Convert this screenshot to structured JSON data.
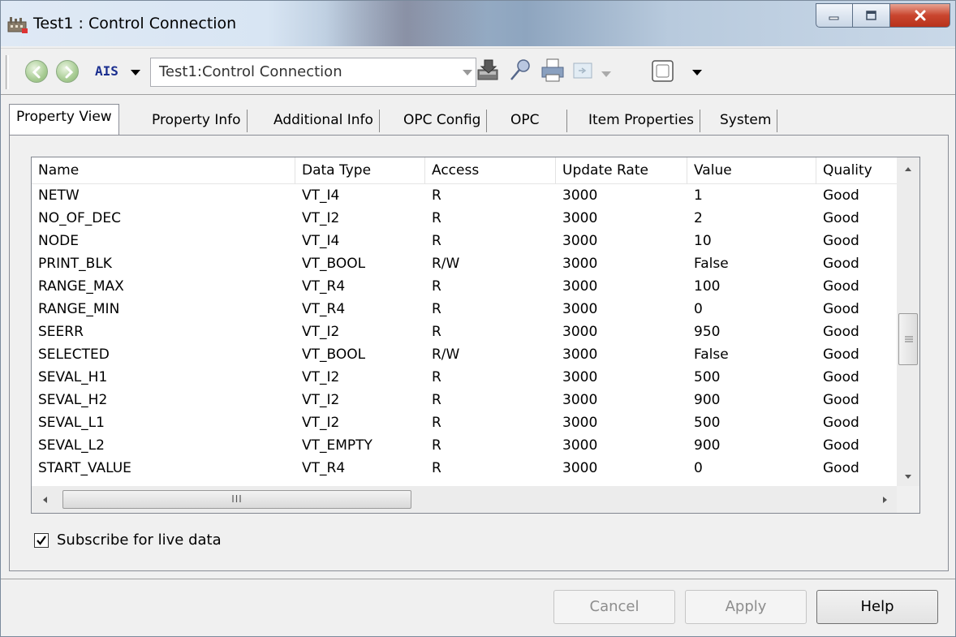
{
  "window": {
    "title": "Test1 : Control Connection",
    "caption_buttons": [
      "minimize-icon",
      "maximize-icon",
      "close-icon"
    ]
  },
  "toolbar": {
    "back_icon": "back-arrow-icon",
    "forward_icon": "forward-arrow-icon",
    "object_type_label": "AIS",
    "address_value": "Test1:Control Connection",
    "tool_icons": [
      "download-icon",
      "pin-icon",
      "print-icon",
      "config-icon",
      "window-icon"
    ]
  },
  "tabs": [
    {
      "label": "Property View",
      "active": true
    },
    {
      "label": "Property Info",
      "active": false
    },
    {
      "label": "Additional Info",
      "active": false
    },
    {
      "label": "OPC Config",
      "active": false
    },
    {
      "label": "OPC",
      "active": false
    },
    {
      "label": "Item Properties",
      "active": false
    },
    {
      "label": "System",
      "active": false
    }
  ],
  "grid": {
    "columns": [
      "Name",
      "Data Type",
      "Access",
      "Update Rate",
      "Value",
      "Quality"
    ],
    "rows": [
      [
        "NETW",
        "VT_I4",
        "R",
        "3000",
        "1",
        "Good"
      ],
      [
        "NO_OF_DEC",
        "VT_I2",
        "R",
        "3000",
        "2",
        "Good"
      ],
      [
        "NODE",
        "VT_I4",
        "R",
        "3000",
        "10",
        "Good"
      ],
      [
        "PRINT_BLK",
        "VT_BOOL",
        "R/W",
        "3000",
        "False",
        "Good"
      ],
      [
        "RANGE_MAX",
        "VT_R4",
        "R",
        "3000",
        "100",
        "Good"
      ],
      [
        "RANGE_MIN",
        "VT_R4",
        "R",
        "3000",
        "0",
        "Good"
      ],
      [
        "SEERR",
        "VT_I2",
        "R",
        "3000",
        "950",
        "Good"
      ],
      [
        "SELECTED",
        "VT_BOOL",
        "R/W",
        "3000",
        "False",
        "Good"
      ],
      [
        "SEVAL_H1",
        "VT_I2",
        "R",
        "3000",
        "500",
        "Good"
      ],
      [
        "SEVAL_H2",
        "VT_I2",
        "R",
        "3000",
        "900",
        "Good"
      ],
      [
        "SEVAL_L1",
        "VT_I2",
        "R",
        "3000",
        "500",
        "Good"
      ],
      [
        "SEVAL_L2",
        "VT_EMPTY",
        "R",
        "3000",
        "900",
        "Good"
      ],
      [
        "START_VALUE",
        "VT_R4",
        "R",
        "3000",
        "0",
        "Good"
      ]
    ],
    "hscroll_thumb_grip": "III"
  },
  "subscribe": {
    "label": "Subscribe for live data",
    "checked": true
  },
  "buttons": {
    "cancel": "Cancel",
    "apply": "Apply",
    "help": "Help"
  }
}
